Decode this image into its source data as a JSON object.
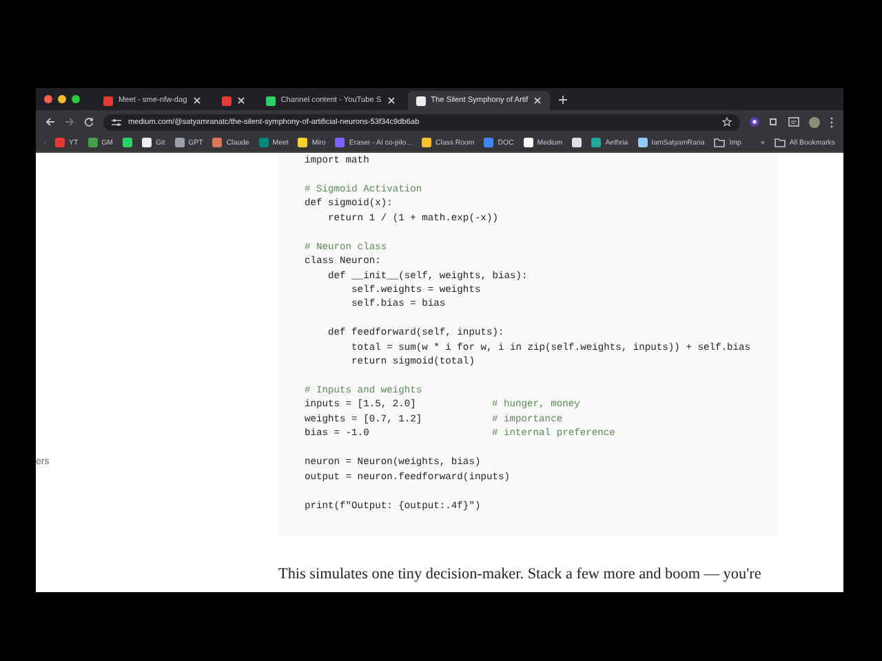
{
  "tabs": [
    {
      "kind": "page",
      "title": "Meet - sme-nfw-dag",
      "selected": false
    },
    {
      "kind": "icon",
      "selected": false
    },
    {
      "kind": "page",
      "title": "Channel content - YouTube S",
      "selected": false
    },
    {
      "kind": "page",
      "title": "The Silent Symphony of Artif",
      "selected": true
    }
  ],
  "address_bar": {
    "url": "medium.com/@satyamranatc/the-silent-symphony-of-artificial-neurons-53f34c9db6ab"
  },
  "bookmarks": [
    {
      "kind": "link",
      "label": "YT"
    },
    {
      "kind": "link",
      "label": "GM"
    },
    {
      "kind": "icon"
    },
    {
      "kind": "link",
      "label": "Git"
    },
    {
      "kind": "link",
      "label": "GPT"
    },
    {
      "kind": "link",
      "label": "Claude"
    },
    {
      "kind": "link",
      "label": "Meet"
    },
    {
      "kind": "link",
      "label": "Miro"
    },
    {
      "kind": "link",
      "label": "Eraser - AI co-pilo..."
    },
    {
      "kind": "link",
      "label": "Class Room"
    },
    {
      "kind": "link",
      "label": "DOC"
    },
    {
      "kind": "link",
      "label": "Medium"
    },
    {
      "kind": "icon"
    },
    {
      "kind": "link",
      "label": "Aethria"
    },
    {
      "kind": "link",
      "label": "IamSatyamRana"
    },
    {
      "kind": "folder",
      "label": "Imp"
    }
  ],
  "bookmarks_overflow": "»",
  "all_bookmarks": "All Bookmarks",
  "sidebar": {
    "text_fragment": "ers"
  },
  "code_block": {
    "lines": [
      {
        "kind": "code",
        "code": "import math"
      },
      {
        "kind": "blank"
      },
      {
        "kind": "comment",
        "comment": "# Sigmoid Activation"
      },
      {
        "kind": "code",
        "code": "def sigmoid(x):"
      },
      {
        "kind": "code",
        "code": "    return 1 / (1 + math.exp(-x))"
      },
      {
        "kind": "blank"
      },
      {
        "kind": "comment",
        "comment": "# Neuron class"
      },
      {
        "kind": "code",
        "code": "class Neuron:"
      },
      {
        "kind": "code",
        "code": "    def __init__(self, weights, bias):"
      },
      {
        "kind": "code",
        "code": "        self.weights = weights"
      },
      {
        "kind": "code",
        "code": "        self.bias = bias"
      },
      {
        "kind": "blank"
      },
      {
        "kind": "code",
        "code": "    def feedforward(self, inputs):"
      },
      {
        "kind": "code",
        "code": "        total = sum(w * i for w, i in zip(self.weights, inputs)) + self.bias"
      },
      {
        "kind": "code",
        "code": "        return sigmoid(total)"
      },
      {
        "kind": "blank"
      },
      {
        "kind": "comment",
        "comment": "# Inputs and weights"
      },
      {
        "kind": "code",
        "code": "inputs = [1.5, 2.0]",
        "comment": "# hunger, money"
      },
      {
        "kind": "code",
        "code": "weights = [0.7, 1.2]",
        "comment": "# importance"
      },
      {
        "kind": "code",
        "code": "bias = -1.0",
        "comment": "# internal preference"
      },
      {
        "kind": "blank"
      },
      {
        "kind": "code",
        "code": "neuron = Neuron(weights, bias)"
      },
      {
        "kind": "code",
        "code": "output = neuron.feedforward(inputs)"
      },
      {
        "kind": "blank"
      },
      {
        "kind": "code",
        "code": "print(f\"Output: {output:.4f}\")"
      }
    ]
  },
  "paragraph": "This simulates one tiny decision-maker. Stack a few more and boom — you're"
}
